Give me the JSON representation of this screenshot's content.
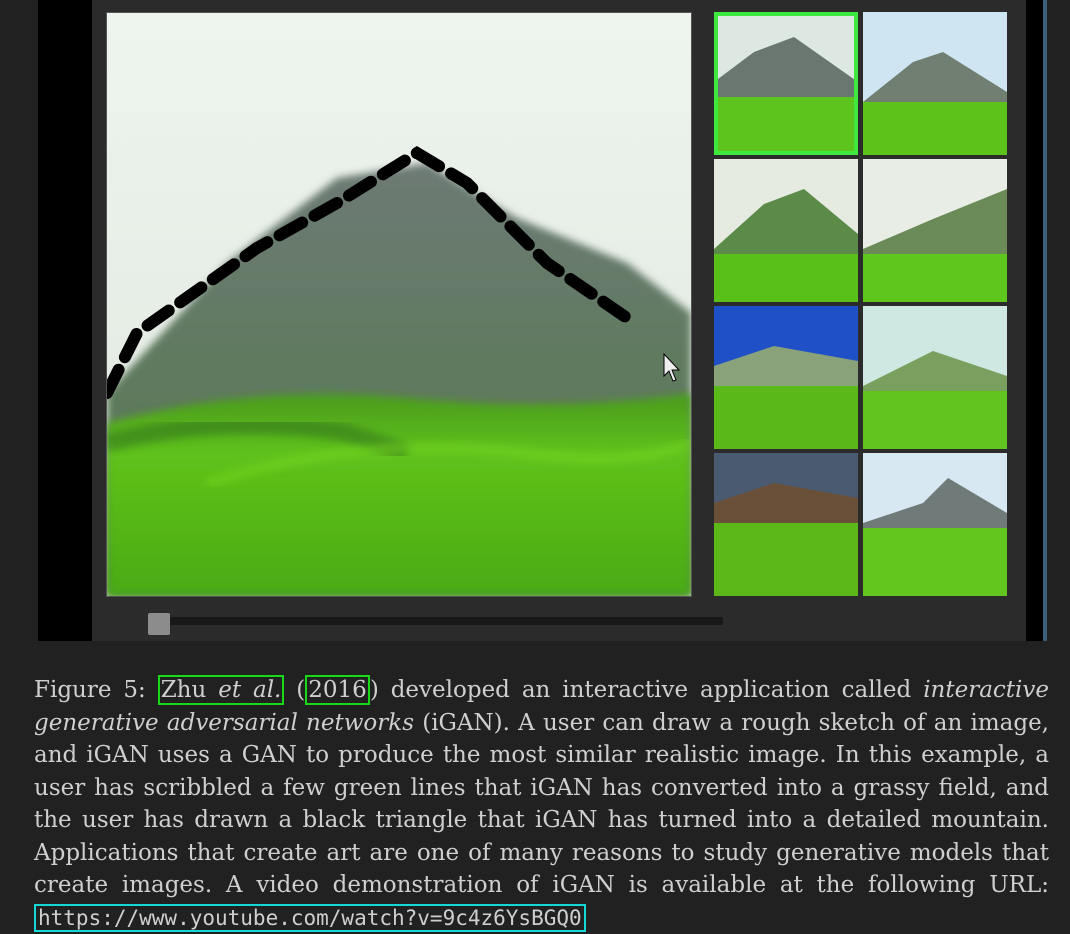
{
  "figure": {
    "caption": {
      "label": "Figure 5:",
      "author": "Zhu",
      "etal": "et al.",
      "year": "2016",
      "after_cite": ") developed an interactive application called",
      "italic_term": "interactive generative adversarial networks",
      "body": "(iGAN). A user can draw a rough sketch of an image, and iGAN uses a GAN to produce the most similar realistic image. In this example, a user has scribbled a few green lines that iGAN has converted into a grassy field, and the user has drawn a black triangle that iGAN has turned into a detailed mountain. Applications that create art are one of many reasons to study generative models that create images. A video demonstration of iGAN is available at the following URL:",
      "url": "https://www.youtube.com/watch?v=9c4z6YsBGQ0"
    },
    "app": {
      "selected_thumbnail": 1,
      "slider_position": 0.0
    },
    "colors": {
      "cite_box": "#18d818",
      "url_box": "#16d7d7",
      "selection": "#3ee83e"
    }
  }
}
